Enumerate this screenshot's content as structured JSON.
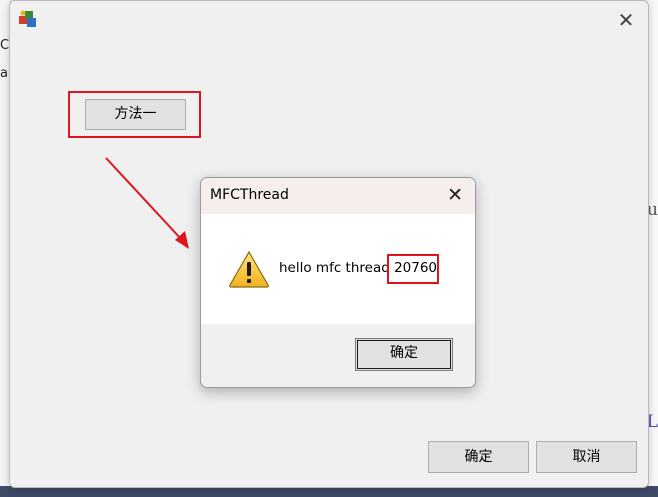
{
  "background": {
    "left_fragments": [
      "C",
      "a"
    ],
    "right_fragments": [
      "u",
      "L"
    ]
  },
  "main_window": {
    "close_glyph": "✕",
    "method1_label": "方法一",
    "ok_label": "确定",
    "cancel_label": "取消"
  },
  "message_box": {
    "title": "MFCThread",
    "close_glyph": "✕",
    "message_prefix": "hello mfc thread ",
    "thread_id": "20760",
    "ok_label": "确定",
    "icon": "warning-icon"
  },
  "annotations": {
    "highlight_color": "#e0141e",
    "arrow_color": "#e0141e"
  }
}
